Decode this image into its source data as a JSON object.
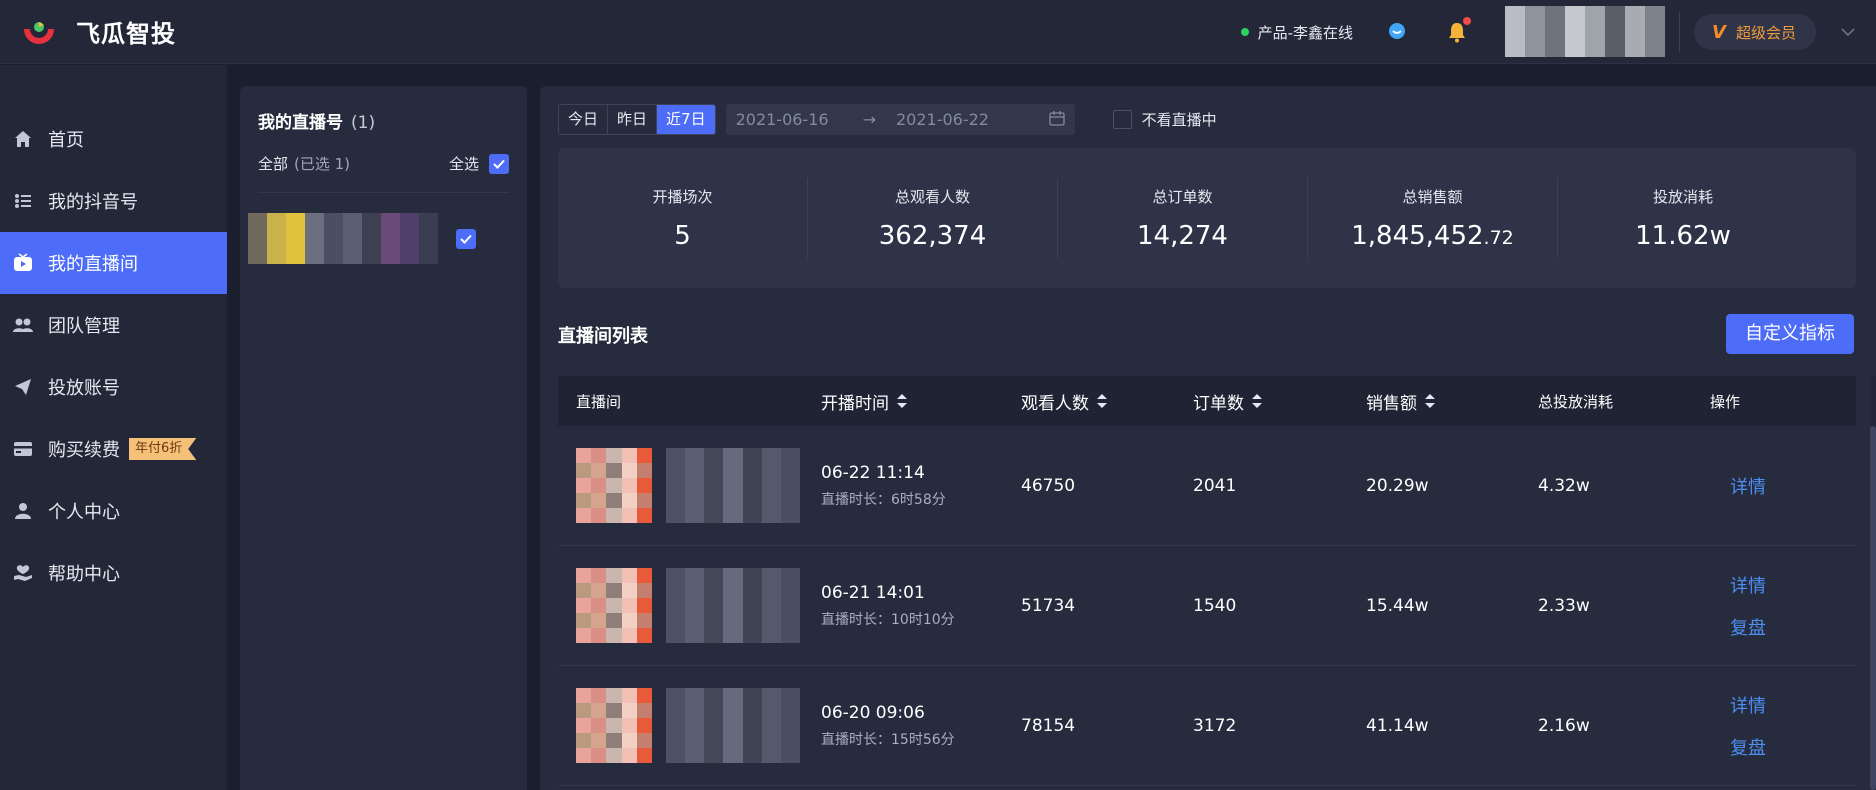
{
  "app": {
    "title": "飞瓜智投",
    "brand_colors": [
      "#e8313f",
      "#4bc46a",
      "#4d6cf8"
    ]
  },
  "topbar": {
    "online_text": "产品-李鑫在线",
    "icons": [
      "chat-bubble-icon",
      "bell-icon"
    ],
    "vip_label": "超级会员",
    "vip_icon": "V"
  },
  "sidebar": {
    "items": [
      {
        "label": "首页",
        "icon": "home-icon"
      },
      {
        "label": "我的抖音号",
        "icon": "list-icon"
      },
      {
        "label": "我的直播间",
        "icon": "live-tv-icon",
        "active": true
      },
      {
        "label": "团队管理",
        "icon": "team-icon"
      },
      {
        "label": "投放账号",
        "icon": "send-icon"
      },
      {
        "label": "购买续费",
        "icon": "card-icon",
        "badge": "年付6折"
      },
      {
        "label": "个人中心",
        "icon": "user-icon"
      },
      {
        "label": "帮助中心",
        "icon": "help-hand-icon"
      }
    ]
  },
  "accounts": {
    "title": "我的直播号",
    "count": "(1)",
    "all_label": "全部",
    "selected_label": "(已选 1)",
    "select_all_label": "全选"
  },
  "filters": {
    "range_buttons": [
      "今日",
      "昨日",
      "近7日"
    ],
    "active_range": "近7日",
    "start_date": "2021-06-16",
    "end_date": "2021-06-22",
    "no_live_label": "不看直播中"
  },
  "stats": [
    {
      "label": "开播场次",
      "value": "5",
      "decimal": ""
    },
    {
      "label": "总观看人数",
      "value": "362,374",
      "decimal": ""
    },
    {
      "label": "总订单数",
      "value": "14,274",
      "decimal": ""
    },
    {
      "label": "总销售额",
      "value": "1,845,452",
      "decimal": ".72"
    },
    {
      "label": "投放消耗",
      "value": "11.62w",
      "decimal": ""
    }
  ],
  "list": {
    "title": "直播间列表",
    "custom_button": "自定义指标",
    "headers": {
      "room": "直播间",
      "start_time": "开播时间",
      "viewers": "观看人数",
      "orders": "订单数",
      "sales": "销售额",
      "ad_spend": "总投放消耗",
      "actions": "操作"
    },
    "rows": [
      {
        "time": "06-22 11:14",
        "duration": "直播时长：6时58分",
        "viewers": "46750",
        "orders": "2041",
        "sales": "20.29w",
        "ad_spend": "4.32w",
        "actions": [
          "详情"
        ]
      },
      {
        "time": "06-21 14:01",
        "duration": "直播时长：10时10分",
        "viewers": "51734",
        "orders": "1540",
        "sales": "15.44w",
        "ad_spend": "2.33w",
        "actions": [
          "详情",
          "复盘"
        ]
      },
      {
        "time": "06-20 09:06",
        "duration": "直播时长：15时56分",
        "viewers": "78154",
        "orders": "3172",
        "sales": "41.14w",
        "ad_spend": "2.16w",
        "actions": [
          "详情",
          "复盘"
        ]
      }
    ]
  }
}
